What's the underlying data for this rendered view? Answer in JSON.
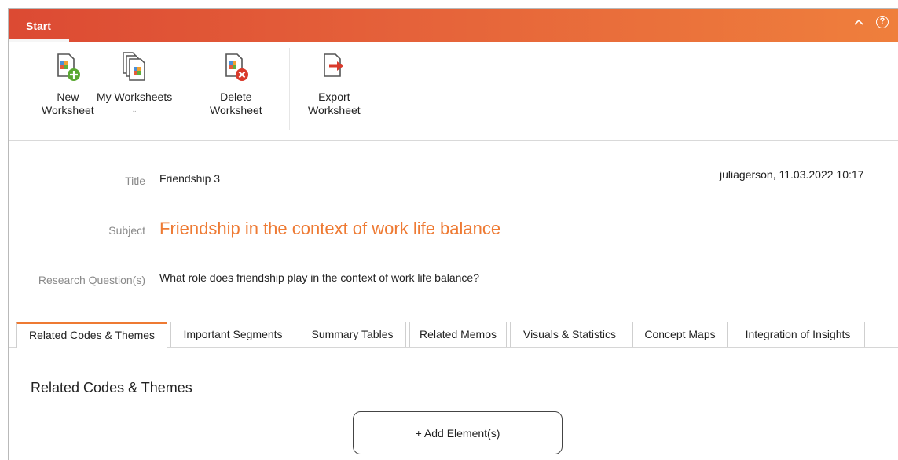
{
  "ribbon": {
    "tab_label": "Start",
    "collapse_glyph": "^",
    "help_glyph": "?"
  },
  "toolbar": {
    "new_worksheet": {
      "line1": "New",
      "line2": "Worksheet",
      "icon": "new-worksheet-icon"
    },
    "my_worksheets": {
      "line1": "My Worksheets",
      "chevron": "⌄",
      "icon": "my-worksheets-icon"
    },
    "delete_worksheet": {
      "line1": "Delete",
      "line2": "Worksheet",
      "icon": "delete-worksheet-icon"
    },
    "export_worksheet": {
      "line1": "Export",
      "line2": "Worksheet",
      "icon": "export-worksheet-icon"
    }
  },
  "worksheet": {
    "title_label": "Title",
    "title_value": "Friendship 3",
    "subject_label": "Subject",
    "subject_value": "Friendship in the context of work life balance",
    "question_label": "Research Question(s)",
    "question_value": "What role does friendship play in the context of work life balance?",
    "meta": "juliagerson, 11.03.2022 10:17"
  },
  "tabs": [
    {
      "label": "Related Codes & Themes",
      "active": true
    },
    {
      "label": "Important Segments",
      "active": false
    },
    {
      "label": "Summary Tables",
      "active": false
    },
    {
      "label": "Related Memos",
      "active": false
    },
    {
      "label": "Visuals & Statistics",
      "active": false
    },
    {
      "label": "Concept Maps",
      "active": false
    },
    {
      "label": "Integration of Insights",
      "active": false
    }
  ],
  "content": {
    "section_title": "Related Codes & Themes",
    "add_button": "+ Add Element(s)"
  },
  "colors": {
    "accent": "#ee7a33",
    "ribbon_start": "#dc4a33",
    "ribbon_end": "#ef7f3c"
  }
}
